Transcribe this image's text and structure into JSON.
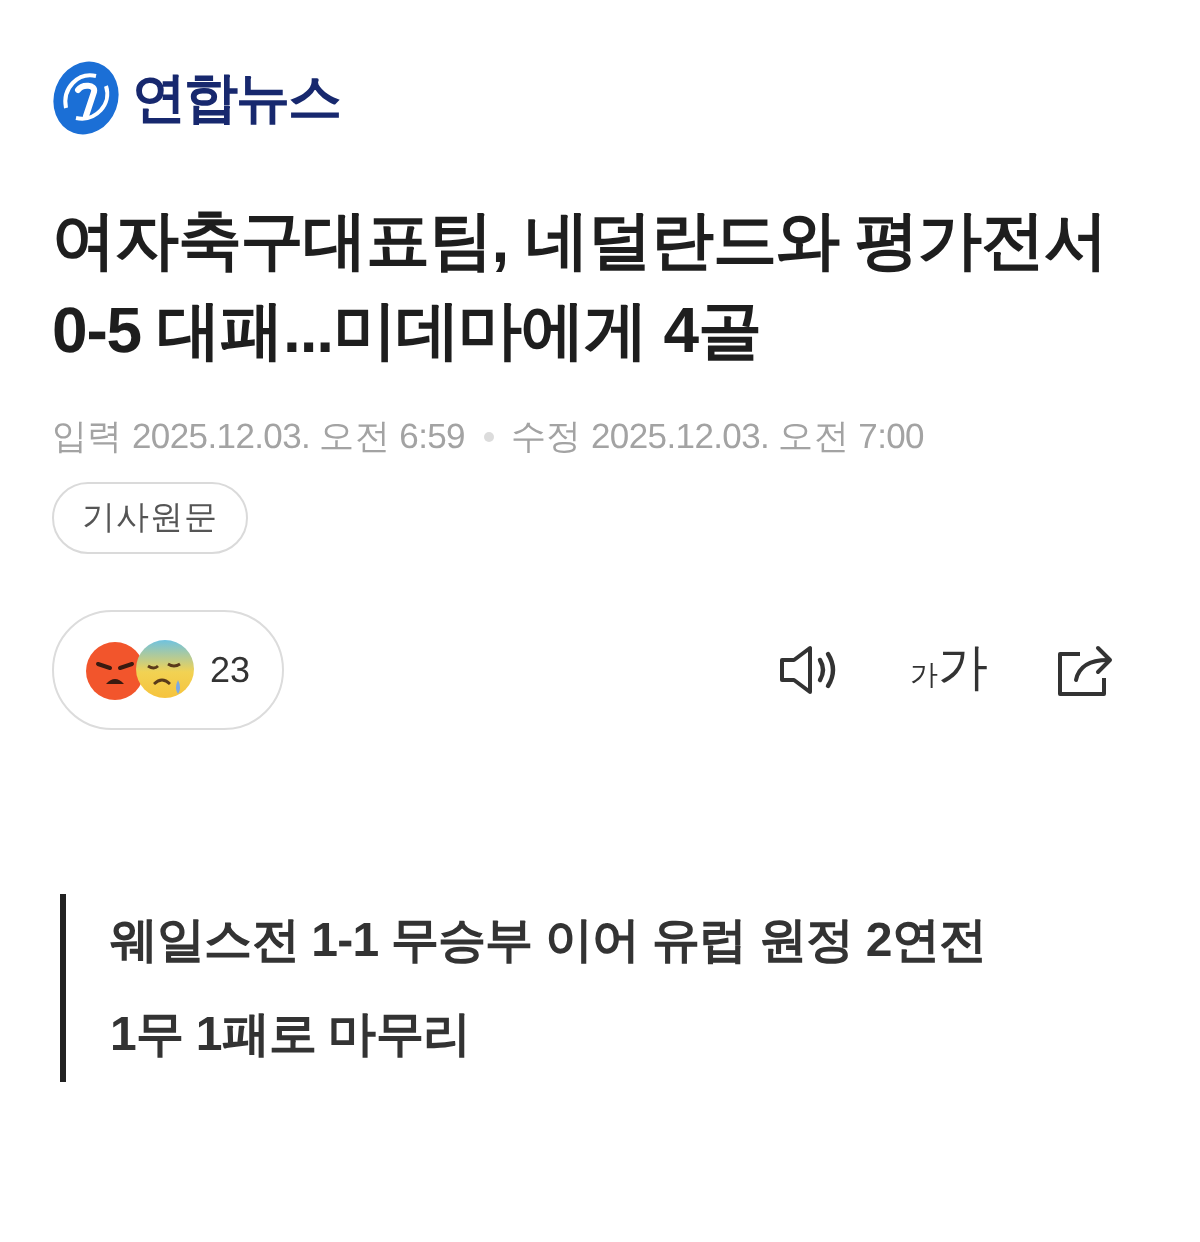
{
  "logo": {
    "text": "연합뉴스"
  },
  "headline": "여자축구대표팀, 네덜란드와 평가전서 0-5 대패...미데마에게 4골",
  "meta": {
    "published": "입력 2025.12.03. 오전 6:59",
    "modified": "수정 2025.12.03. 오전 7:00"
  },
  "original_article_button": "기사원문",
  "reactions": {
    "count": "23"
  },
  "font_size_button": {
    "small_glyph": "가",
    "large_glyph": "가"
  },
  "subheadline": "웨일스전 1-1 무승부 이어 유럽 원정 2연전 1무 1패로 마무리"
}
